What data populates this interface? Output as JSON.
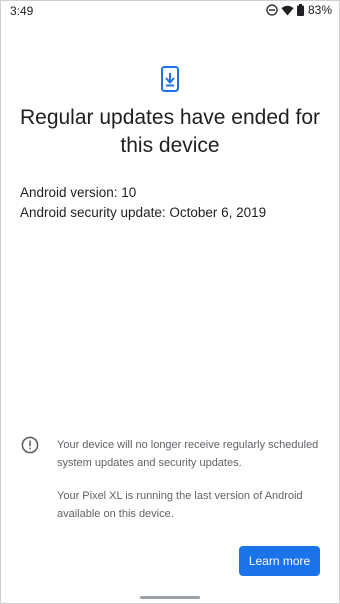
{
  "status_bar": {
    "time": "3:49",
    "battery_percent": "83%",
    "icons": [
      "do-not-disturb-icon",
      "wifi-icon",
      "battery-icon"
    ]
  },
  "screen": {
    "icon": "system-update-phone-icon",
    "title": "Regular updates have ended for this device",
    "android_version": "Android version: 10",
    "security_update": "Android security update: October 6, 2019"
  },
  "notice": {
    "icon": "info-alert-icon",
    "paragraph_1": "Your device will no longer receive regularly scheduled system updates and security updates.",
    "paragraph_2": "Your Pixel XL is running the last version of Android available on this device."
  },
  "actions": {
    "learn_more_label": "Learn more"
  },
  "colors": {
    "accent": "#1a73e8",
    "text_primary": "#202124",
    "text_secondary": "#5f6368"
  }
}
